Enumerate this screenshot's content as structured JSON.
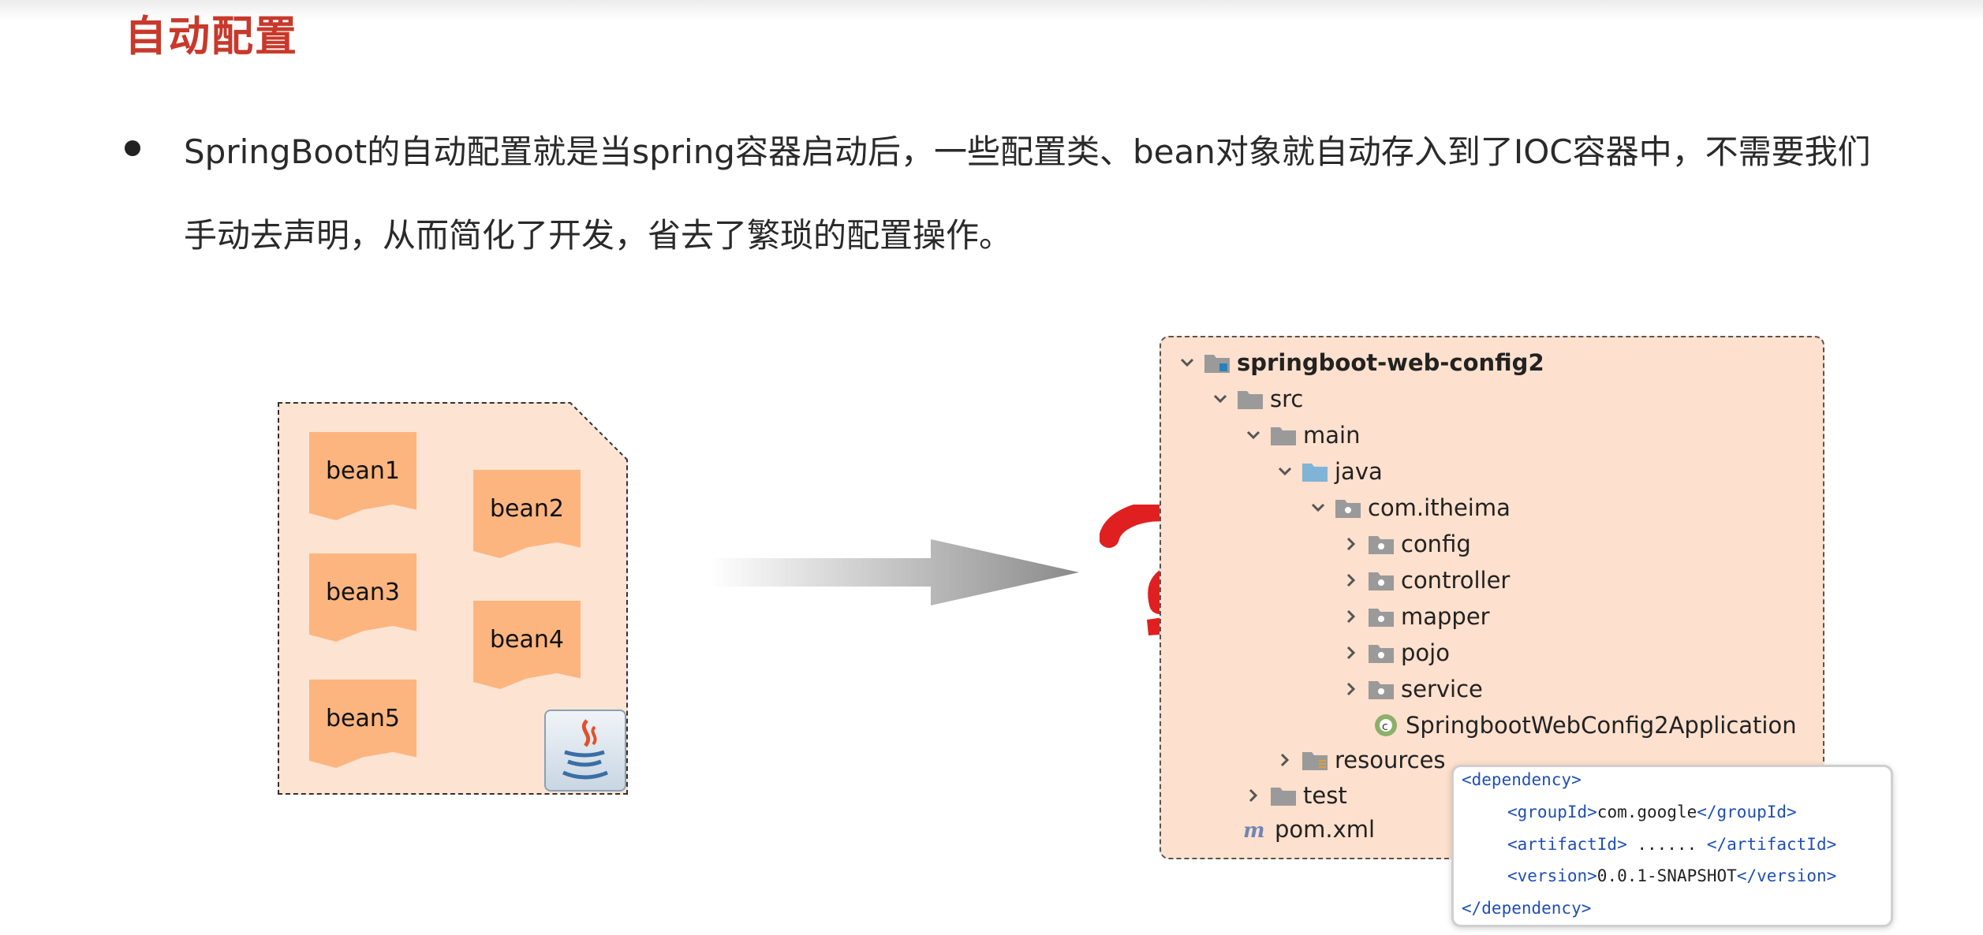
{
  "slide": {
    "title": "自动配置",
    "description": "SpringBoot的自动配置就是当spring容器启动后，一些配置类、bean对象就自动存入到了IOC容器中，不需要我们手动去声明，从而简化了开发，省去了繁琐的配置操作。"
  },
  "beans": [
    "bean1",
    "bean2",
    "bean3",
    "bean4",
    "bean5"
  ],
  "tree": {
    "project": "springboot-web-config2",
    "src": "src",
    "main": "main",
    "java": "java",
    "package": "com.itheima",
    "subpackages": [
      "config",
      "controller",
      "mapper",
      "pojo",
      "service"
    ],
    "app_class": "SpringbootWebConfig2Application",
    "resources": "resources",
    "test": "test",
    "pom": "pom.xml"
  },
  "xml": {
    "dependency_open": "<dependency>",
    "groupId_open": "<groupId>",
    "groupId_value": "com.google",
    "groupId_close": "</groupId>",
    "artifactId_open": "<artifactId>",
    "artifactId_value": " ...... ",
    "artifactId_close": "</artifactId>",
    "version_open": "<version>",
    "version_value": "0.0.1-SNAPSHOT",
    "version_close": "</version>",
    "dependency_close": "</dependency>"
  },
  "colors": {
    "title": "#c8392b",
    "bean": "#fcb57f",
    "panel": "#fde0cd",
    "question": "#e02020",
    "xml_tag": "#1f4fb5"
  },
  "icons": [
    "chevron-down-icon",
    "chevron-right-icon",
    "folder-icon",
    "java-icon",
    "spring-boot-class-icon",
    "maven-icon",
    "question-mark-icon",
    "arrow-icon",
    "mouse-cursor-icon"
  ]
}
